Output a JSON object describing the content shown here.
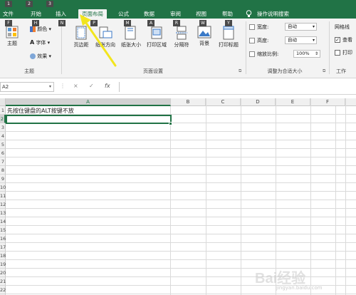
{
  "app": {
    "title": "工作簿1"
  },
  "top_keytips": [
    "1",
    "2",
    "3"
  ],
  "tabs": [
    {
      "label": "文件",
      "key": "F"
    },
    {
      "label": "开始",
      "key": "H"
    },
    {
      "label": "插入",
      "key": "N"
    },
    {
      "label": "页面布局",
      "key": "P",
      "active": true
    },
    {
      "label": "公式",
      "key": "M"
    },
    {
      "label": "数据",
      "key": "A"
    },
    {
      "label": "审阅",
      "key": "R"
    },
    {
      "label": "视图",
      "key": "W"
    },
    {
      "label": "帮助",
      "key": "Y"
    }
  ],
  "tell_me": "操作说明搜索",
  "ribbon": {
    "theme_group": {
      "label": "主题",
      "theme_button": "主题",
      "colors": "颜色",
      "fonts": "字体",
      "effects": "效果"
    },
    "page_setup_group": {
      "label": "页面设置",
      "buttons": [
        "页边距",
        "纸张方向",
        "纸张大小",
        "打印区域",
        "分隔符",
        "背景",
        "打印标题"
      ]
    },
    "scale_group": {
      "label": "调整为合适大小",
      "width_label": "宽度:",
      "width_value": "自动",
      "height_label": "高度:",
      "height_value": "自动",
      "scale_label": "缩放比例:",
      "scale_value": "100%"
    },
    "sheet_options_group": {
      "label": "工作",
      "gridlines": "网格线",
      "view_abbr": "查看",
      "print_abbr": "打印",
      "view_checked": true,
      "print_checked": false
    }
  },
  "formula_bar": {
    "name_box": "A2",
    "cancel_icon": "×",
    "enter_icon": "✓",
    "fx_icon": "fx",
    "value": ""
  },
  "grid": {
    "columns": [
      "A",
      "B",
      "C",
      "D",
      "E",
      "F",
      "G"
    ],
    "rows": [
      "1",
      "2",
      "3",
      "4",
      "5",
      "6",
      "7",
      "8",
      "9",
      "10",
      "11",
      "12",
      "13",
      "14",
      "15",
      "16",
      "17",
      "18",
      "19",
      "20",
      "21",
      "22",
      "23"
    ],
    "selected_cell": "A2",
    "cells": {
      "A1": "先按住键盘的ALT按键不放"
    }
  },
  "watermark": {
    "text": "Bai经验",
    "sub": "jingyan.baidu.com"
  },
  "colors": {
    "excel_green": "#217346",
    "ribbon_bg": "#f3f3f3",
    "arrow_yellow": "#f2e51e"
  }
}
